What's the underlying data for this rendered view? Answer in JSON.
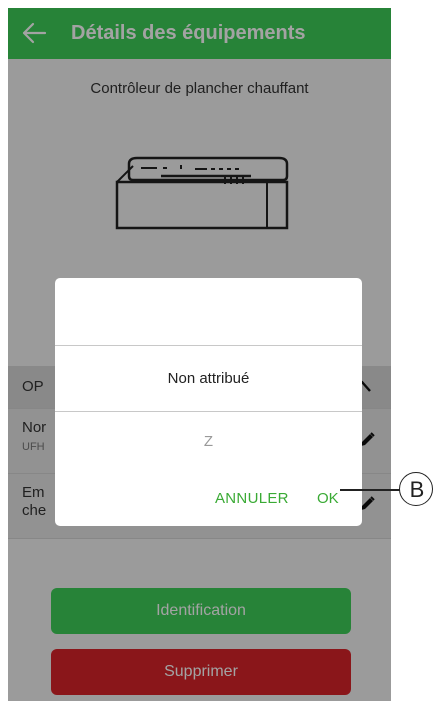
{
  "header": {
    "title": "Détails des équipements",
    "back_icon": "arrow-left-icon",
    "color": "#3dcd58"
  },
  "device": {
    "name": "Contrôleur de plancher chauffant",
    "image_icon": "floor-heating-controller-icon"
  },
  "options_section": {
    "label_partial": "OP",
    "chevron_icon": "chevron-up-icon"
  },
  "rows": {
    "name": {
      "title_partial": "Nor",
      "subtitle_partial": "UFH"
    },
    "location": {
      "line1_partial": "Em",
      "line2_partial": "che"
    }
  },
  "buttons": {
    "identify": "Identification",
    "delete": "Supprimer",
    "identify_color": "#3dcd58",
    "delete_color": "#d8232a"
  },
  "dialog": {
    "options": [
      "Non attribué",
      "Z"
    ],
    "cancel_label": "ANNULER",
    "ok_label": "OK",
    "accent": "#3aaa35"
  },
  "callout": {
    "label": "B"
  }
}
